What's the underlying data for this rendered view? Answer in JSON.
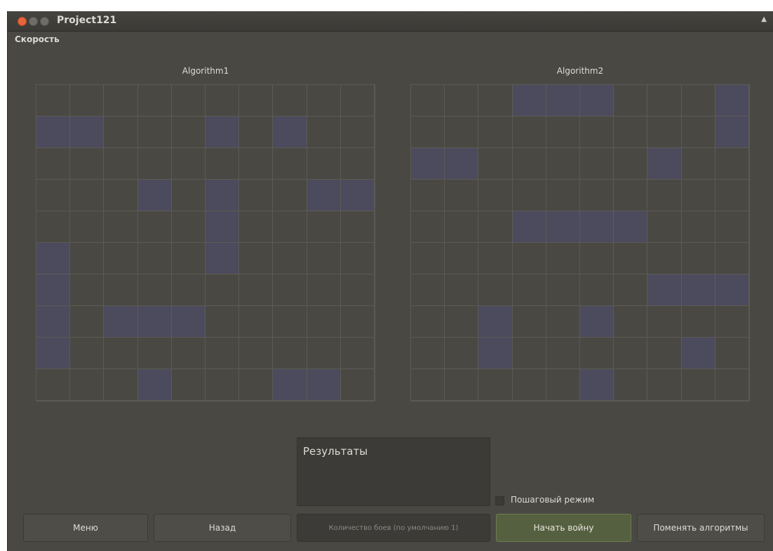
{
  "window": {
    "title": "Project121"
  },
  "menubar": {
    "speed_label": "Скорость"
  },
  "boards": [
    {
      "title": "Algorithm1",
      "ships": [
        [
          0,
          1,
          2,
          1
        ],
        [
          5,
          1,
          1,
          1
        ],
        [
          7,
          1,
          1,
          1
        ],
        [
          3,
          3,
          1,
          1
        ],
        [
          5,
          3,
          1,
          3
        ],
        [
          8,
          3,
          2,
          1
        ],
        [
          0,
          5,
          1,
          4
        ],
        [
          2,
          7,
          3,
          1
        ],
        [
          3,
          9,
          1,
          1
        ],
        [
          7,
          9,
          2,
          1
        ]
      ]
    },
    {
      "title": "Algorithm2",
      "ships": [
        [
          3,
          0,
          3,
          1
        ],
        [
          9,
          0,
          1,
          2
        ],
        [
          0,
          2,
          2,
          1
        ],
        [
          7,
          2,
          1,
          1
        ],
        [
          3,
          4,
          4,
          1
        ],
        [
          7,
          6,
          3,
          1
        ],
        [
          2,
          7,
          1,
          2
        ],
        [
          5,
          7,
          1,
          1
        ],
        [
          8,
          8,
          1,
          1
        ],
        [
          5,
          9,
          1,
          1
        ]
      ]
    }
  ],
  "results": {
    "label": "Результаты"
  },
  "step_mode": {
    "label": "Пошаговый режим",
    "checked": false
  },
  "buttons": {
    "menu": "Меню",
    "back": "Назад",
    "start": "Начать войну",
    "swap": "Поменять алгоритмы"
  },
  "battles_input": {
    "placeholder": "Количество боев (по умолчанию 1)"
  },
  "colors": {
    "ship": "#4c4b5d",
    "background": "#4a4843",
    "accent": "#6d7d4f"
  }
}
